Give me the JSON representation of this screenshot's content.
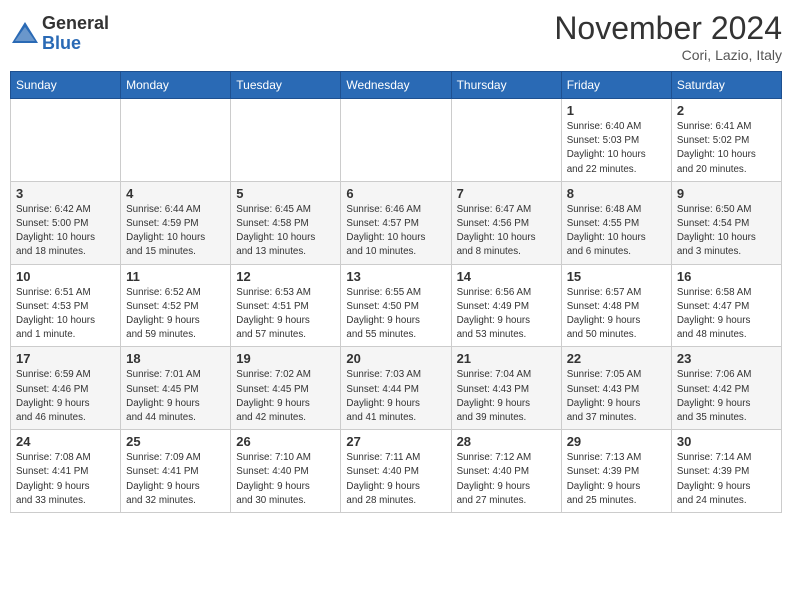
{
  "logo": {
    "general": "General",
    "blue": "Blue"
  },
  "title": "November 2024",
  "location": "Cori, Lazio, Italy",
  "days_of_week": [
    "Sunday",
    "Monday",
    "Tuesday",
    "Wednesday",
    "Thursday",
    "Friday",
    "Saturday"
  ],
  "weeks": [
    [
      {
        "day": "",
        "info": ""
      },
      {
        "day": "",
        "info": ""
      },
      {
        "day": "",
        "info": ""
      },
      {
        "day": "",
        "info": ""
      },
      {
        "day": "",
        "info": ""
      },
      {
        "day": "1",
        "info": "Sunrise: 6:40 AM\nSunset: 5:03 PM\nDaylight: 10 hours\nand 22 minutes."
      },
      {
        "day": "2",
        "info": "Sunrise: 6:41 AM\nSunset: 5:02 PM\nDaylight: 10 hours\nand 20 minutes."
      }
    ],
    [
      {
        "day": "3",
        "info": "Sunrise: 6:42 AM\nSunset: 5:00 PM\nDaylight: 10 hours\nand 18 minutes."
      },
      {
        "day": "4",
        "info": "Sunrise: 6:44 AM\nSunset: 4:59 PM\nDaylight: 10 hours\nand 15 minutes."
      },
      {
        "day": "5",
        "info": "Sunrise: 6:45 AM\nSunset: 4:58 PM\nDaylight: 10 hours\nand 13 minutes."
      },
      {
        "day": "6",
        "info": "Sunrise: 6:46 AM\nSunset: 4:57 PM\nDaylight: 10 hours\nand 10 minutes."
      },
      {
        "day": "7",
        "info": "Sunrise: 6:47 AM\nSunset: 4:56 PM\nDaylight: 10 hours\nand 8 minutes."
      },
      {
        "day": "8",
        "info": "Sunrise: 6:48 AM\nSunset: 4:55 PM\nDaylight: 10 hours\nand 6 minutes."
      },
      {
        "day": "9",
        "info": "Sunrise: 6:50 AM\nSunset: 4:54 PM\nDaylight: 10 hours\nand 3 minutes."
      }
    ],
    [
      {
        "day": "10",
        "info": "Sunrise: 6:51 AM\nSunset: 4:53 PM\nDaylight: 10 hours\nand 1 minute."
      },
      {
        "day": "11",
        "info": "Sunrise: 6:52 AM\nSunset: 4:52 PM\nDaylight: 9 hours\nand 59 minutes."
      },
      {
        "day": "12",
        "info": "Sunrise: 6:53 AM\nSunset: 4:51 PM\nDaylight: 9 hours\nand 57 minutes."
      },
      {
        "day": "13",
        "info": "Sunrise: 6:55 AM\nSunset: 4:50 PM\nDaylight: 9 hours\nand 55 minutes."
      },
      {
        "day": "14",
        "info": "Sunrise: 6:56 AM\nSunset: 4:49 PM\nDaylight: 9 hours\nand 53 minutes."
      },
      {
        "day": "15",
        "info": "Sunrise: 6:57 AM\nSunset: 4:48 PM\nDaylight: 9 hours\nand 50 minutes."
      },
      {
        "day": "16",
        "info": "Sunrise: 6:58 AM\nSunset: 4:47 PM\nDaylight: 9 hours\nand 48 minutes."
      }
    ],
    [
      {
        "day": "17",
        "info": "Sunrise: 6:59 AM\nSunset: 4:46 PM\nDaylight: 9 hours\nand 46 minutes."
      },
      {
        "day": "18",
        "info": "Sunrise: 7:01 AM\nSunset: 4:45 PM\nDaylight: 9 hours\nand 44 minutes."
      },
      {
        "day": "19",
        "info": "Sunrise: 7:02 AM\nSunset: 4:45 PM\nDaylight: 9 hours\nand 42 minutes."
      },
      {
        "day": "20",
        "info": "Sunrise: 7:03 AM\nSunset: 4:44 PM\nDaylight: 9 hours\nand 41 minutes."
      },
      {
        "day": "21",
        "info": "Sunrise: 7:04 AM\nSunset: 4:43 PM\nDaylight: 9 hours\nand 39 minutes."
      },
      {
        "day": "22",
        "info": "Sunrise: 7:05 AM\nSunset: 4:43 PM\nDaylight: 9 hours\nand 37 minutes."
      },
      {
        "day": "23",
        "info": "Sunrise: 7:06 AM\nSunset: 4:42 PM\nDaylight: 9 hours\nand 35 minutes."
      }
    ],
    [
      {
        "day": "24",
        "info": "Sunrise: 7:08 AM\nSunset: 4:41 PM\nDaylight: 9 hours\nand 33 minutes."
      },
      {
        "day": "25",
        "info": "Sunrise: 7:09 AM\nSunset: 4:41 PM\nDaylight: 9 hours\nand 32 minutes."
      },
      {
        "day": "26",
        "info": "Sunrise: 7:10 AM\nSunset: 4:40 PM\nDaylight: 9 hours\nand 30 minutes."
      },
      {
        "day": "27",
        "info": "Sunrise: 7:11 AM\nSunset: 4:40 PM\nDaylight: 9 hours\nand 28 minutes."
      },
      {
        "day": "28",
        "info": "Sunrise: 7:12 AM\nSunset: 4:40 PM\nDaylight: 9 hours\nand 27 minutes."
      },
      {
        "day": "29",
        "info": "Sunrise: 7:13 AM\nSunset: 4:39 PM\nDaylight: 9 hours\nand 25 minutes."
      },
      {
        "day": "30",
        "info": "Sunrise: 7:14 AM\nSunset: 4:39 PM\nDaylight: 9 hours\nand 24 minutes."
      }
    ]
  ]
}
